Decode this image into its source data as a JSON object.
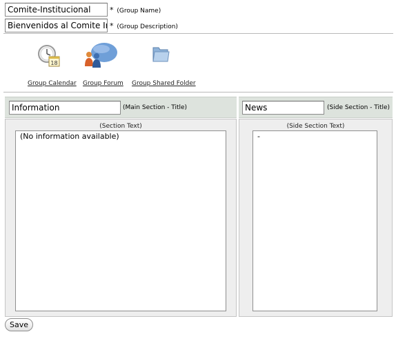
{
  "group": {
    "name_value": "Comite-Institucional",
    "name_note": "(Group Name)",
    "description_value": "Bienvenidos al Comite Inst",
    "description_note": "(Group Description)",
    "required_mark": "*"
  },
  "tools": [
    {
      "label": "Group Calendar",
      "icon": "calendar-clock-icon",
      "calendar_day": "18"
    },
    {
      "label": "Group Forum",
      "icon": "forum-people-icon"
    },
    {
      "label": "Group Shared Folder",
      "icon": "folder-icon"
    }
  ],
  "main_section": {
    "title_value": "Information",
    "title_note": "(Main Section - Title)",
    "caption": "(Section Text)",
    "text": "(No information available)"
  },
  "side_section": {
    "title_value": "News",
    "title_note": "(Side Section - Title)",
    "caption": "(Side Section Text)",
    "text": "-"
  },
  "actions": {
    "save_label": "Save"
  },
  "colors": {
    "band": "#dde3dd",
    "panel": "#eeeeee",
    "folder": "#8fb3d9",
    "forum_bubble": "#6f9fd8"
  }
}
